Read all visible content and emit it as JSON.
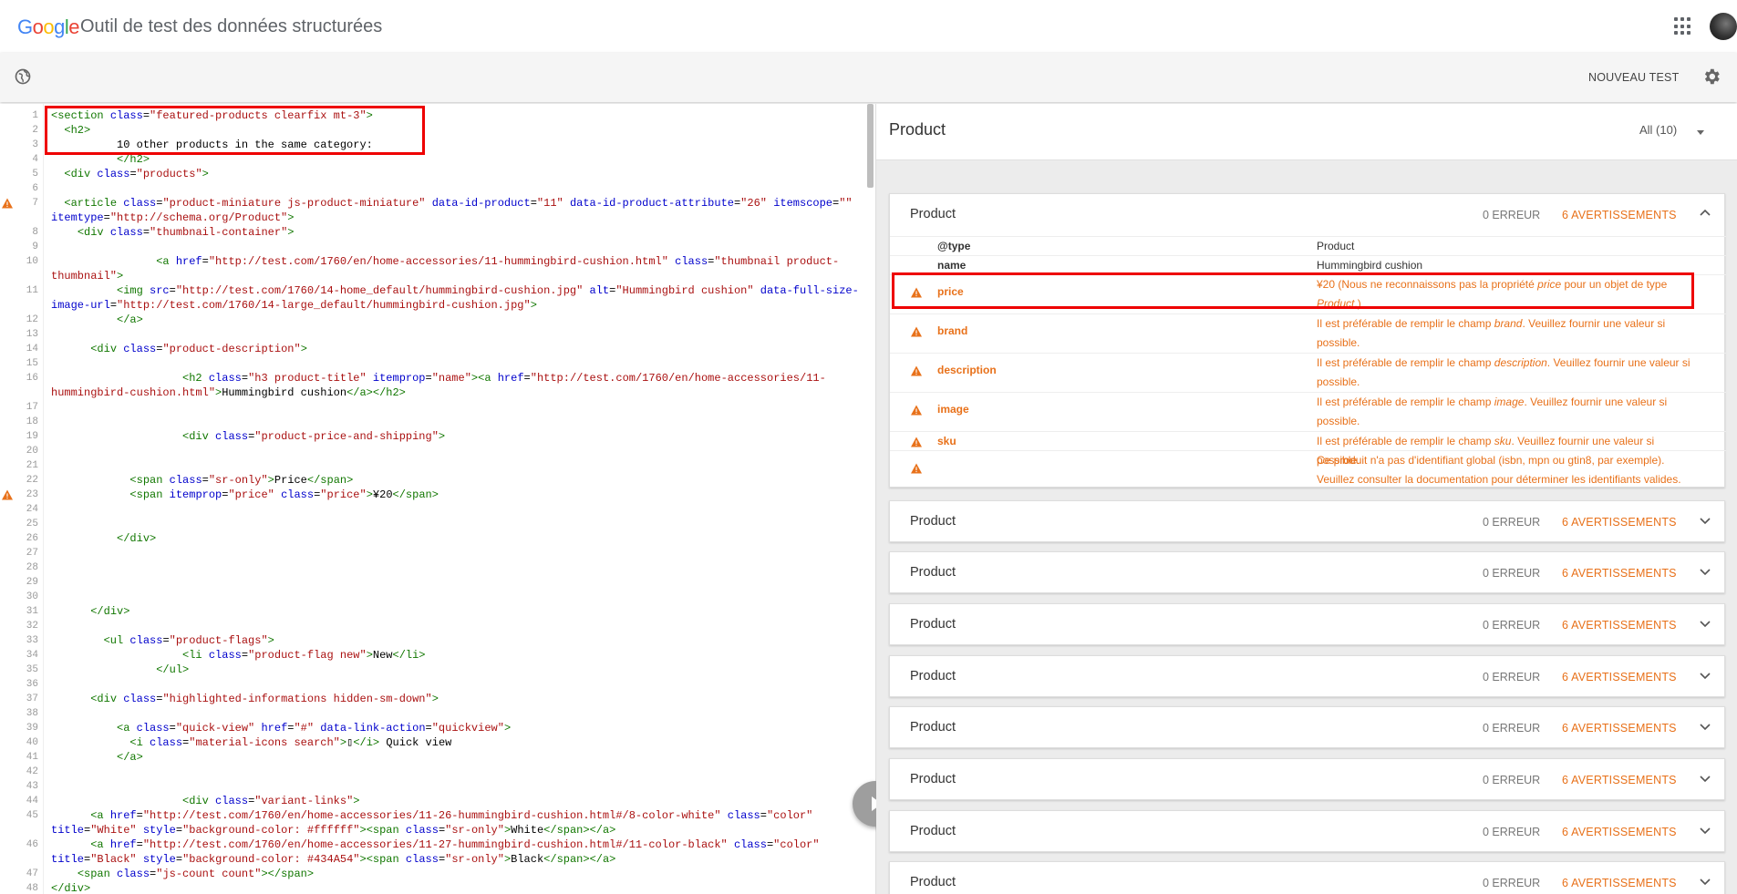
{
  "app": {
    "logo": {
      "letters": [
        "G",
        "o",
        "o",
        "g",
        "l",
        "e"
      ]
    },
    "title": "Outil de test des données structurées",
    "new_test": "NOUVEAU TEST"
  },
  "code": {
    "lines": [
      {
        "n": "1",
        "html": "<span class='t'>&lt;section</span> <span class='a'>class</span>=<span class='s'>\"featured-products clearfix mt-3\"</span><span class='t'>&gt;</span>"
      },
      {
        "n": "2",
        "html": "  <span class='t'>&lt;h2&gt;</span>"
      },
      {
        "n": "3",
        "html": "          10 other products in the same category:"
      },
      {
        "n": "4",
        "html": "          <span class='t'>&lt;/h2&gt;</span>"
      },
      {
        "n": "5",
        "html": "  <span class='t'>&lt;div</span> <span class='a'>class</span>=<span class='s'>\"products\"</span><span class='t'>&gt;</span>"
      },
      {
        "n": "6",
        "html": ""
      },
      {
        "n": "7",
        "warn": true,
        "html": "  <span class='t'>&lt;article</span> <span class='a'>class</span>=<span class='s'>\"product-miniature js-product-miniature\"</span> <span class='a'>data-id-product</span>=<span class='s'>\"11\"</span> <span class='a'>data-id-product-attribute</span>=<span class='s'>\"26\"</span> <span class='a'>itemscope</span>=<span class='s'>\"\"</span>"
      },
      {
        "n": "",
        "html": "<span class='a'>itemtype</span>=<span class='s'>\"http://schema.org/Product\"</span><span class='t'>&gt;</span>"
      },
      {
        "n": "8",
        "html": "    <span class='t'>&lt;div</span> <span class='a'>class</span>=<span class='s'>\"thumbnail-container\"</span><span class='t'>&gt;</span>"
      },
      {
        "n": "9",
        "html": ""
      },
      {
        "n": "10",
        "html": "                <span class='t'>&lt;a</span> <span class='a'>href</span>=<span class='s'>\"http://test.com/1760/en/home-accessories/11-hummingbird-cushion.html\"</span> <span class='a'>class</span>=<span class='s'>\"thumbnail product-</span>"
      },
      {
        "n": "",
        "html": "<span class='s'>thumbnail\"</span><span class='t'>&gt;</span>"
      },
      {
        "n": "11",
        "html": "          <span class='t'>&lt;img</span> <span class='a'>src</span>=<span class='s'>\"http://test.com/1760/14-home_default/hummingbird-cushion.jpg\"</span> <span class='a'>alt</span>=<span class='s'>\"Hummingbird cushion\"</span> <span class='a'>data-full-size-</span>"
      },
      {
        "n": "",
        "html": "<span class='a'>image-url</span>=<span class='s'>\"http://test.com/1760/14-large_default/hummingbird-cushion.jpg\"</span><span class='t'>&gt;</span>"
      },
      {
        "n": "12",
        "html": "          <span class='t'>&lt;/a&gt;</span>"
      },
      {
        "n": "13",
        "html": ""
      },
      {
        "n": "14",
        "html": "      <span class='t'>&lt;div</span> <span class='a'>class</span>=<span class='s'>\"product-description\"</span><span class='t'>&gt;</span>"
      },
      {
        "n": "15",
        "html": ""
      },
      {
        "n": "16",
        "html": "                    <span class='t'>&lt;h2</span> <span class='a'>class</span>=<span class='s'>\"h3 product-title\"</span> <span class='a'>itemprop</span>=<span class='s'>\"name\"</span><span class='t'>&gt;&lt;a</span> <span class='a'>href</span>=<span class='s'>\"http://test.com/1760/en/home-accessories/11-</span>"
      },
      {
        "n": "",
        "html": "<span class='s'>hummingbird-cushion.html\"</span><span class='t'>&gt;</span>Hummingbird cushion<span class='t'>&lt;/a&gt;&lt;/h2&gt;</span>"
      },
      {
        "n": "17",
        "html": ""
      },
      {
        "n": "18",
        "html": ""
      },
      {
        "n": "19",
        "html": "                    <span class='t'>&lt;div</span> <span class='a'>class</span>=<span class='s'>\"product-price-and-shipping\"</span><span class='t'>&gt;</span>"
      },
      {
        "n": "20",
        "html": ""
      },
      {
        "n": "21",
        "html": ""
      },
      {
        "n": "22",
        "html": "            <span class='t'>&lt;span</span> <span class='a'>class</span>=<span class='s'>\"sr-only\"</span><span class='t'>&gt;</span>Price<span class='t'>&lt;/span&gt;</span>"
      },
      {
        "n": "23",
        "warn": true,
        "html": "            <span class='t'>&lt;span</span> <span class='a'>itemprop</span>=<span class='s'>\"price\"</span> <span class='a'>class</span>=<span class='s'>\"price\"</span><span class='t'>&gt;</span>¥20<span class='t'>&lt;/span&gt;</span>"
      },
      {
        "n": "24",
        "html": ""
      },
      {
        "n": "25",
        "html": ""
      },
      {
        "n": "26",
        "html": "          <span class='t'>&lt;/div&gt;</span>"
      },
      {
        "n": "27",
        "html": ""
      },
      {
        "n": "28",
        "html": ""
      },
      {
        "n": "29",
        "html": ""
      },
      {
        "n": "30",
        "html": ""
      },
      {
        "n": "31",
        "html": "      <span class='t'>&lt;/div&gt;</span>"
      },
      {
        "n": "32",
        "html": ""
      },
      {
        "n": "33",
        "html": "        <span class='t'>&lt;ul</span> <span class='a'>class</span>=<span class='s'>\"product-flags\"</span><span class='t'>&gt;</span>"
      },
      {
        "n": "34",
        "html": "                    <span class='t'>&lt;li</span> <span class='a'>class</span>=<span class='s'>\"product-flag new\"</span><span class='t'>&gt;</span>New<span class='t'>&lt;/li&gt;</span>"
      },
      {
        "n": "35",
        "html": "                <span class='t'>&lt;/ul&gt;</span>"
      },
      {
        "n": "36",
        "html": ""
      },
      {
        "n": "37",
        "html": "      <span class='t'>&lt;div</span> <span class='a'>class</span>=<span class='s'>\"highlighted-informations hidden-sm-down\"</span><span class='t'>&gt;</span>"
      },
      {
        "n": "38",
        "html": ""
      },
      {
        "n": "39",
        "html": "          <span class='t'>&lt;a</span> <span class='a'>class</span>=<span class='s'>\"quick-view\"</span> <span class='a'>href</span>=<span class='s'>\"#\"</span> <span class='a'>data-link-action</span>=<span class='s'>\"quickview\"</span><span class='t'>&gt;</span>"
      },
      {
        "n": "40",
        "html": "            <span class='t'>&lt;i</span> <span class='a'>class</span>=<span class='s'>\"material-icons search\"</span><span class='t'>&gt;</span>&#9647;<span class='t'>&lt;/i&gt;</span> Quick view"
      },
      {
        "n": "41",
        "html": "          <span class='t'>&lt;/a&gt;</span>"
      },
      {
        "n": "42",
        "html": ""
      },
      {
        "n": "43",
        "html": ""
      },
      {
        "n": "44",
        "html": "                    <span class='t'>&lt;div</span> <span class='a'>class</span>=<span class='s'>\"variant-links\"</span><span class='t'>&gt;</span>"
      },
      {
        "n": "45",
        "html": "      <span class='t'>&lt;a</span> <span class='a'>href</span>=<span class='s'>\"http://test.com/1760/en/home-accessories/11-26-hummingbird-cushion.html#/8-color-white\"</span> <span class='a'>class</span>=<span class='s'>\"color\"</span>"
      },
      {
        "n": "",
        "html": "<span class='a'>title</span>=<span class='s'>\"White\"</span> <span class='a'>style</span>=<span class='s'>\"background-color: #ffffff\"</span><span class='t'>&gt;&lt;span</span> <span class='a'>class</span>=<span class='s'>\"sr-only\"</span><span class='t'>&gt;</span>White<span class='t'>&lt;/span&gt;&lt;/a&gt;</span>"
      },
      {
        "n": "46",
        "html": "      <span class='t'>&lt;a</span> <span class='a'>href</span>=<span class='s'>\"http://test.com/1760/en/home-accessories/11-27-hummingbird-cushion.html#/11-color-black\"</span> <span class='a'>class</span>=<span class='s'>\"color\"</span>"
      },
      {
        "n": "",
        "html": "<span class='a'>title</span>=<span class='s'>\"Black\"</span> <span class='a'>style</span>=<span class='s'>\"background-color: #434A54\"</span><span class='t'>&gt;&lt;span</span> <span class='a'>class</span>=<span class='s'>\"sr-only\"</span><span class='t'>&gt;</span>Black<span class='t'>&lt;/span&gt;&lt;/a&gt;</span>"
      },
      {
        "n": "47",
        "html": "    <span class='t'>&lt;span</span> <span class='a'>class</span>=<span class='s'>\"js-count count\"</span><span class='t'>&gt;&lt;/span&gt;</span>"
      },
      {
        "n": "48",
        "html": "<span class='t'>&lt;/div&gt;</span>"
      }
    ]
  },
  "results": {
    "title": "Product",
    "filter": "All (10)",
    "expanded": {
      "title": "Product",
      "errors": "0 ERREUR",
      "warnings": "6 AVERTISSEMENTS",
      "props": [
        {
          "key": "@type",
          "value": "Product",
          "warn": false
        },
        {
          "key": "name",
          "value": "Hummingbird cushion",
          "warn": false
        },
        {
          "key": "price",
          "value_html": "¥20 (Nous ne reconnaissons pas la propriété <i>price</i> pour un objet de type <i>Product</i>.)",
          "warn": true
        },
        {
          "key": "brand",
          "value_html": "Il est préférable de remplir le champ <i>brand</i>. Veuillez fournir une valeur si possible.",
          "warn": true
        },
        {
          "key": "description",
          "value_html": "Il est préférable de remplir le champ <i>description</i>. Veuillez fournir une valeur si possible.",
          "warn": true
        },
        {
          "key": "image",
          "value_html": "Il est préférable de remplir le champ <i>image</i>. Veuillez fournir une valeur si possible.",
          "warn": true
        },
        {
          "key": "sku",
          "value_html": "Il est préférable de remplir le champ <i>sku</i>. Veuillez fournir une valeur si possible.",
          "warn": true
        },
        {
          "key": "",
          "value_html": "Ce produit n'a pas d'identifiant global (isbn, mpn ou gtin8, par exemple). Veuillez consulter la documentation pour déterminer les identifiants valides.",
          "warn": true
        }
      ]
    },
    "collapsed": [
      {
        "title": "Product",
        "errors": "0 ERREUR",
        "warnings": "6 AVERTISSEMENTS"
      },
      {
        "title": "Product",
        "errors": "0 ERREUR",
        "warnings": "6 AVERTISSEMENTS"
      },
      {
        "title": "Product",
        "errors": "0 ERREUR",
        "warnings": "6 AVERTISSEMENTS"
      },
      {
        "title": "Product",
        "errors": "0 ERREUR",
        "warnings": "6 AVERTISSEMENTS"
      },
      {
        "title": "Product",
        "errors": "0 ERREUR",
        "warnings": "6 AVERTISSEMENTS"
      },
      {
        "title": "Product",
        "errors": "0 ERREUR",
        "warnings": "6 AVERTISSEMENTS"
      },
      {
        "title": "Product",
        "errors": "0 ERREUR",
        "warnings": "6 AVERTISSEMENTS"
      },
      {
        "title": "Product",
        "errors": "0 ERREUR",
        "warnings": "6 AVERTISSEMENTS"
      }
    ]
  },
  "colors": {
    "warning": "#e8711a",
    "highlight": "#e00000",
    "tag": "#117700",
    "attr": "#0000cc",
    "string": "#aa1111"
  }
}
